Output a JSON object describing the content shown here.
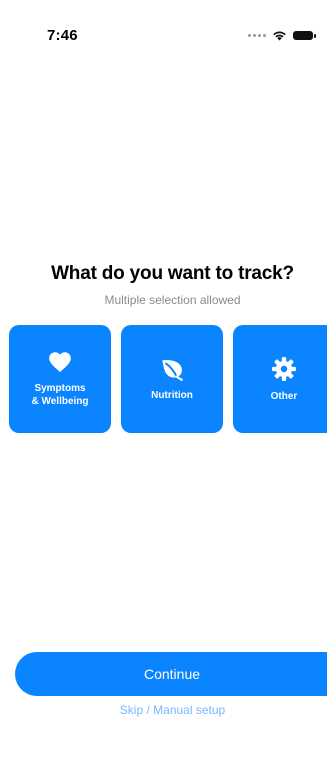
{
  "status_bar": {
    "time": "7:46",
    "icons": [
      "signal-dots-icon",
      "wifi-icon",
      "battery-icon"
    ]
  },
  "main": {
    "title": "What do you want to track?",
    "subtitle": "Multiple selection allowed",
    "options": [
      {
        "label_line1": "Symptoms",
        "label_line2": "& Wellbeing",
        "icon": "heart-icon"
      },
      {
        "label_line1": "Nutrition",
        "icon": "leaf-icon"
      },
      {
        "label_line1": "Other",
        "icon": "gear-icon"
      }
    ]
  },
  "footer": {
    "continue_label": "Continue",
    "skip_label": "Skip / Manual setup"
  },
  "colors": {
    "accent": "#0a84ff",
    "subtitle": "#8a8a8f",
    "link": "#79b8ff"
  }
}
